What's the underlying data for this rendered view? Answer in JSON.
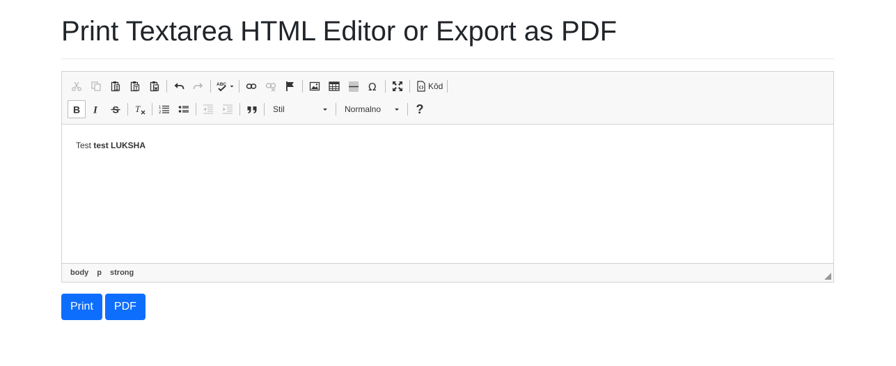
{
  "page": {
    "title": "Print Textarea HTML Editor or Export as PDF"
  },
  "toolbar": {
    "source_label": "Kôd",
    "style_combo": "Stil",
    "format_combo": "Normalno",
    "help_label": "?"
  },
  "content": {
    "plain": "Test ",
    "bold": "test LUKSHA"
  },
  "elements_path": [
    "body",
    "p",
    "strong"
  ],
  "actions": {
    "print": "Print",
    "pdf": "PDF"
  },
  "colors": {
    "primary": "#0d6efd",
    "toolbar_bg": "#f8f8f8",
    "border": "#d1d1d1"
  }
}
